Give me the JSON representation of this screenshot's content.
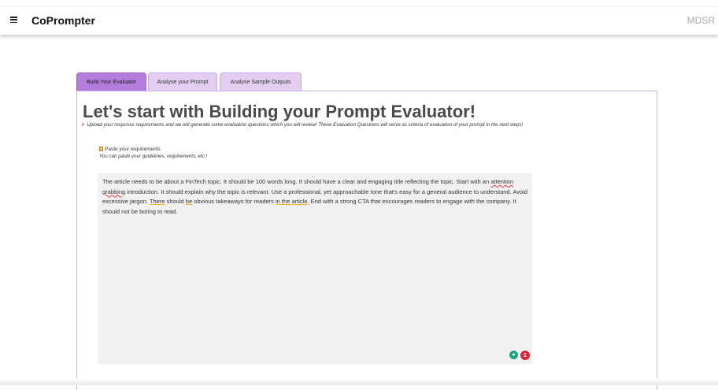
{
  "app": {
    "name": "CoPrompter",
    "org": "MDSR"
  },
  "tabs": [
    {
      "label": "Build Your Evaluator",
      "active": true
    },
    {
      "label": "Analyse your Prompt",
      "active": false
    },
    {
      "label": "Analyse Sample Outputs",
      "active": false
    }
  ],
  "page": {
    "title": "Let's start with Building your Prompt Evaluator!",
    "subtitle": "Upload your response requirements and we will generate some evaluation questions which you will review! These Evaluation Questions will serve as criteria of evaluation of your prompt in the next steps!"
  },
  "requirements": {
    "label": "Paste your requirements",
    "hint": "You can paste your guidelines, requirements, etc.!",
    "text_parts": [
      "The article needs to be about a FinTech topic. It should be 100 words long. It should have a clear and engaging title reflecting the topic. Start with an ",
      "attention grabbing",
      " introduction. It should explain why the topic is relevant. Use a professional, yet approachable tone that's easy for a general audience to understand. Avoid excessive jargon. ",
      "There",
      " should ",
      "be",
      " obvious takeaways for readers ",
      "in the article",
      ".  End with a strong CTA that encourages readers to engage with the company. It should not be boring to read."
    ]
  },
  "assistant": {
    "issue_count": "1"
  },
  "colors": {
    "active_tab": "#b47ddc",
    "inactive_tab": "#e3cdf0",
    "panel_border": "#cfb3e6",
    "badge": "#d9243b",
    "bulb": "#19a67d"
  }
}
